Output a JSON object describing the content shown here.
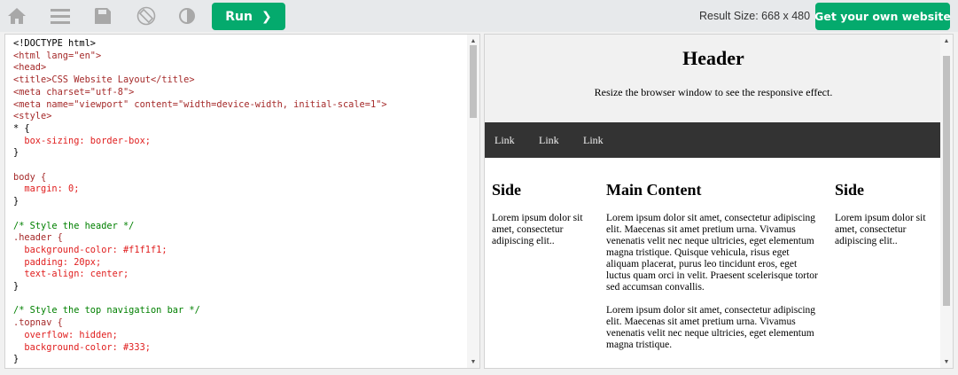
{
  "toolbar": {
    "icons": [
      "home-icon",
      "menu-icon",
      "save-icon",
      "rotate-icon",
      "contrast-icon"
    ],
    "run_label": "Run",
    "result_size_label": "Result Size: 668 x 480",
    "own_website_label": "Get your own website"
  },
  "colors": {
    "accent": "#04aa6d",
    "toolbar_bg": "#e7e9eb",
    "nav_bg": "#333333"
  },
  "editor": {
    "lines": [
      "<!DOCTYPE html>",
      "<html lang=\"en\">",
      "<head>",
      "<title>CSS Website Layout</title>",
      "<meta charset=\"utf-8\">",
      "<meta name=\"viewport\" content=\"width=device-width, initial-scale=1\">",
      "<style>",
      "* {",
      "  box-sizing: border-box;",
      "}",
      "",
      "body {",
      "  margin: 0;",
      "}",
      "",
      "/* Style the header */",
      ".header {",
      "  background-color: #f1f1f1;",
      "  padding: 20px;",
      "  text-align: center;",
      "}",
      "",
      "/* Style the top navigation bar */",
      ".topnav {",
      "  overflow: hidden;",
      "  background-color: #333;",
      "}"
    ]
  },
  "result": {
    "header_title": "Header",
    "header_text": "Resize the browser window to see the responsive effect.",
    "nav_links": [
      "Link",
      "Link",
      "Link"
    ],
    "left_side": {
      "title": "Side",
      "text": "Lorem ipsum dolor sit amet, consectetur adipiscing elit.."
    },
    "main": {
      "title": "Main Content",
      "para1": "Lorem ipsum dolor sit amet, consectetur adipiscing elit. Maecenas sit amet pretium urna. Vivamus venenatis velit nec neque ultricies, eget elementum magna tristique. Quisque vehicula, risus eget aliquam placerat, purus leo tincidunt eros, eget luctus quam orci in velit. Praesent scelerisque tortor sed accumsan convallis.",
      "para2": "Lorem ipsum dolor sit amet, consectetur adipiscing elit. Maecenas sit amet pretium urna. Vivamus venenatis velit nec neque ultricies, eget elementum magna tristique."
    },
    "right_side": {
      "title": "Side",
      "text": "Lorem ipsum dolor sit amet, consectetur adipiscing elit.."
    }
  }
}
